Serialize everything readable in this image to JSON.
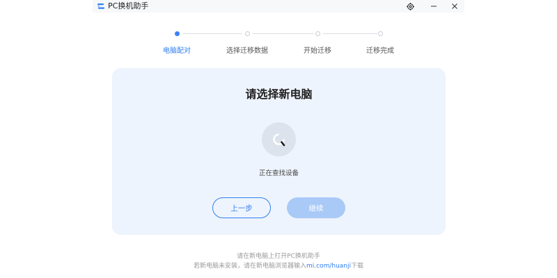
{
  "window": {
    "title": "PC换机助手"
  },
  "steps": [
    {
      "label": "电脑配对",
      "active": true
    },
    {
      "label": "选择迁移数据",
      "active": false
    },
    {
      "label": "开始迁移",
      "active": false
    },
    {
      "label": "迁移完成",
      "active": false
    }
  ],
  "card": {
    "title": "请选择新电脑",
    "status": "正在查找设备",
    "back_label": "上一步",
    "next_label": "继续"
  },
  "footer": {
    "line1": "请在新电脑上打开PC换机助手",
    "line2_prefix": "若新电脑未安装，请在新电脑浏览器输入",
    "line2_link": "mi.com/huanji",
    "line2_suffix": "下载"
  },
  "colors": {
    "accent": "#2f7ef2",
    "card_bg": "#eef4fd",
    "disabled_button": "#a9c9f7"
  }
}
